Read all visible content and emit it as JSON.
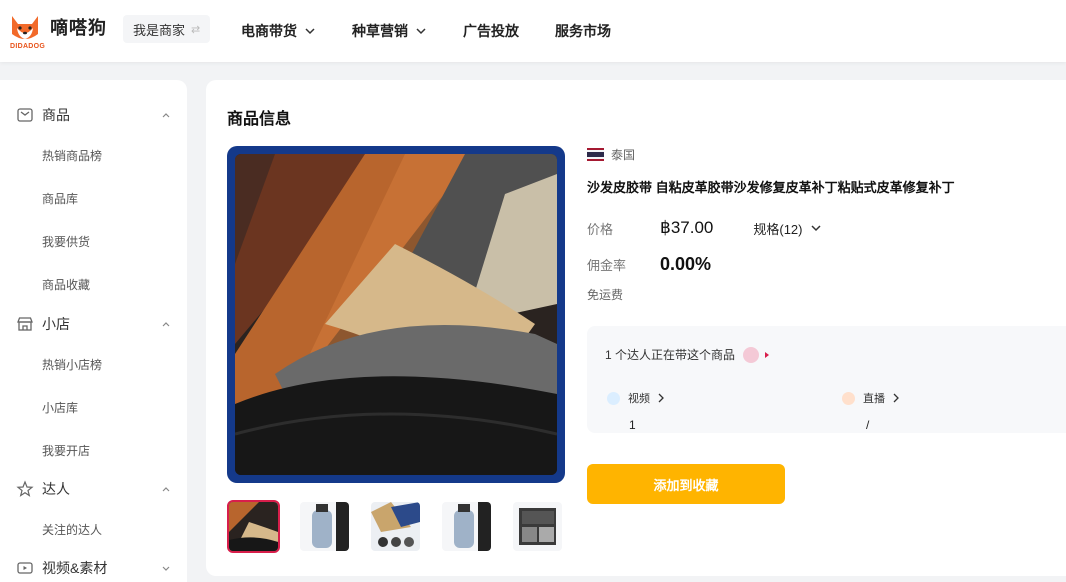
{
  "brand": {
    "name": "嘀嗒狗",
    "sub": "DIDADOG"
  },
  "merchant_switch": {
    "label": "我是商家",
    "icon": "swap-icon"
  },
  "nav": [
    {
      "label": "电商带货",
      "has_dropdown": true
    },
    {
      "label": "种草营销",
      "has_dropdown": true
    },
    {
      "label": "广告投放",
      "has_dropdown": false
    },
    {
      "label": "服务市场",
      "has_dropdown": false
    }
  ],
  "sidebar": {
    "sections": [
      {
        "label": "商品",
        "icon": "product-box-icon",
        "items": [
          "热销商品榜",
          "商品库",
          "我要供货",
          "商品收藏"
        ]
      },
      {
        "label": "小店",
        "icon": "store-icon",
        "items": [
          "热销小店榜",
          "小店库",
          "我要开店"
        ]
      },
      {
        "label": "达人",
        "icon": "star-icon",
        "items": [
          "关注的达人"
        ]
      },
      {
        "label": "视频&素材",
        "icon": "video-icon",
        "items": []
      }
    ]
  },
  "product": {
    "section_title": "商品信息",
    "country": "泰国",
    "title": "沙发皮胶带 自粘皮革胶带沙发修复皮革补丁粘贴式皮革修复补丁",
    "price_label": "价格",
    "price": "฿37.00",
    "spec_label": "规格(12)",
    "commission_label": "佣金率",
    "commission": "0.00%",
    "shipping": "免运费",
    "creators_text": "1 个达人正在带这个商品",
    "video_label": "视频",
    "video_count": "1",
    "live_label": "直播",
    "live_count": "/",
    "add_button": "添加到收藏"
  },
  "colors": {
    "accent": "#ffb400",
    "hero_border": "#14398a",
    "thumb_active": "#d81e4b"
  }
}
